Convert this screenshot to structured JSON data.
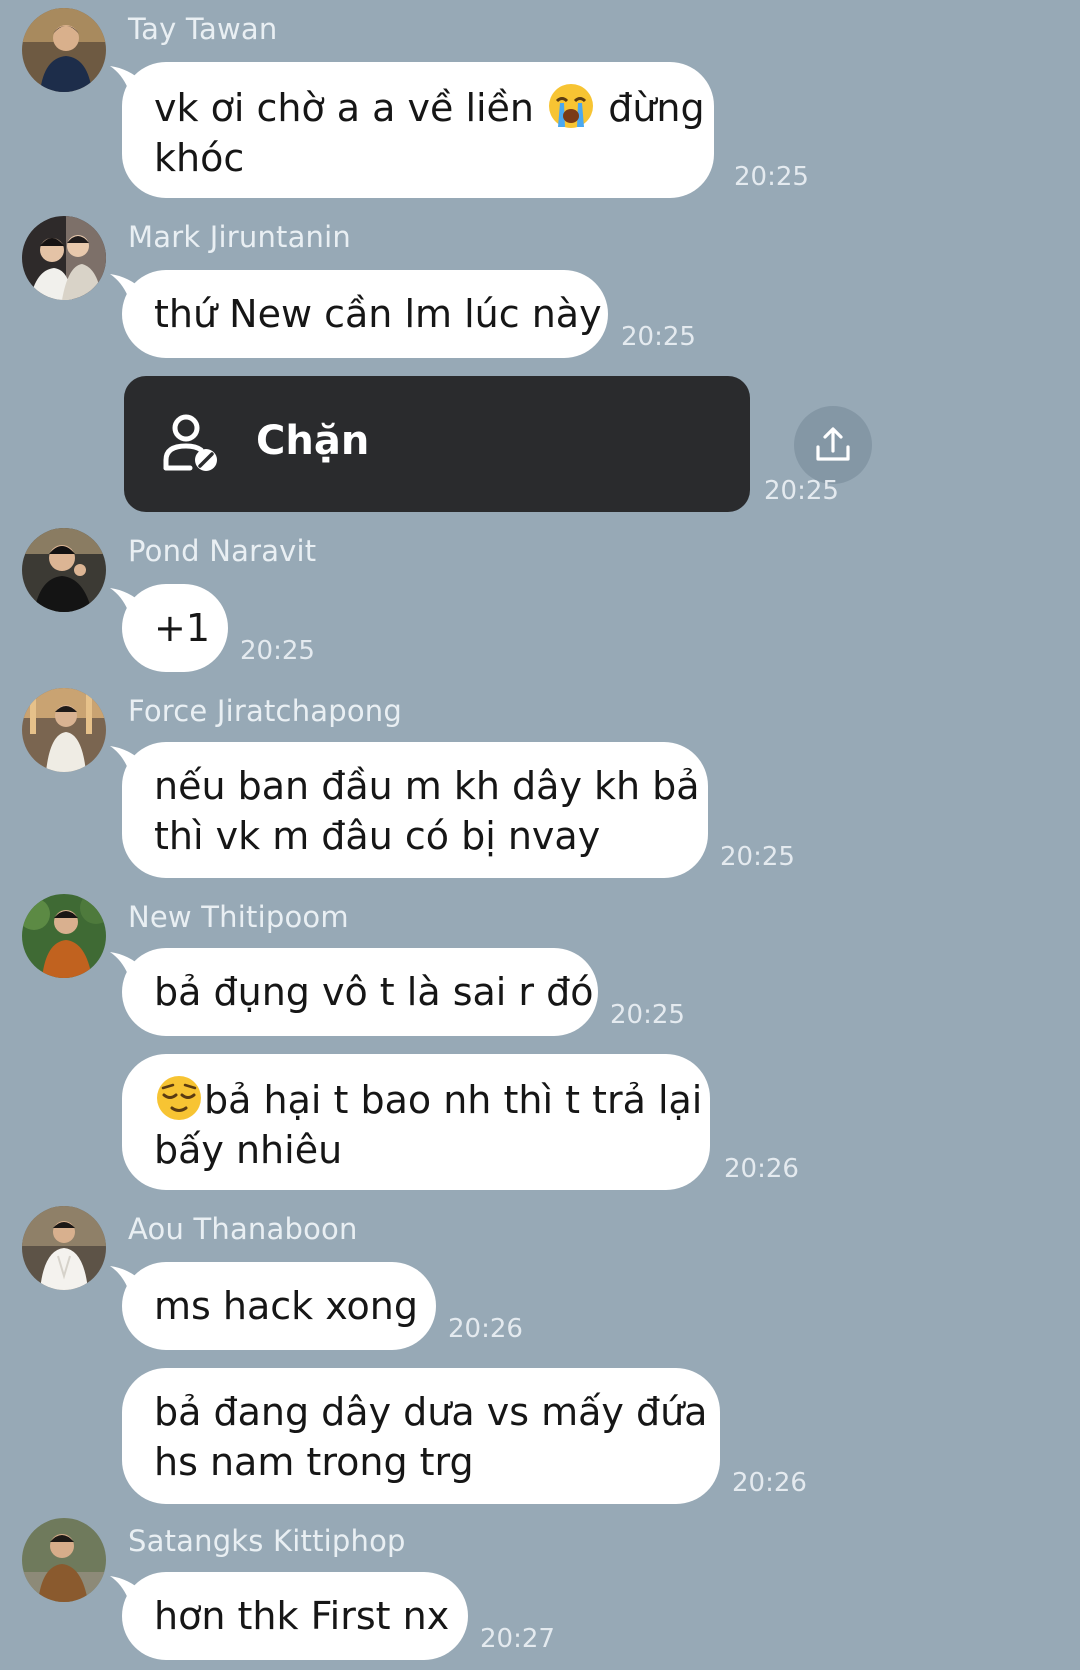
{
  "colors": {
    "background": "#97a9b6",
    "bubble": "#ffffff",
    "block_card": "#2a2b2d",
    "sender_text": "#e9eff3",
    "time_text": "#e4eaef"
  },
  "messages": [
    {
      "sender": "Tay Tawan",
      "bubbles": [
        {
          "line1_before": "vk ơi chờ a a về liền",
          "line1_after": "đừng",
          "line2": "khóc",
          "time": "20:25"
        }
      ]
    },
    {
      "sender": "Mark Jiruntanin",
      "bubbles": [
        {
          "text": "thứ New cần lm lúc này",
          "time": "20:25"
        }
      ]
    },
    {
      "block_card": {
        "icon": "block-user-icon",
        "label": "Chặn",
        "time": "20:25",
        "share_icon": "share-upload-icon"
      }
    },
    {
      "sender": "Pond Naravit",
      "bubbles": [
        {
          "text": "+1",
          "time": "20:25"
        }
      ]
    },
    {
      "sender": "Force Jiratchapong",
      "bubbles": [
        {
          "line1": "nếu ban đầu m kh dây kh bả",
          "line2": "thì vk m đâu có bị nvay",
          "time": "20:25"
        }
      ]
    },
    {
      "sender": "New Thitipoom",
      "bubbles": [
        {
          "text": "bả đụng vô t là sai r đó",
          "time": "20:25"
        },
        {
          "line1": "bả hại t bao nh thì t trả lại",
          "line2": "bấy nhiêu",
          "time": "20:26"
        }
      ]
    },
    {
      "sender": "Aou Thanaboon",
      "bubbles": [
        {
          "text": "ms hack xong",
          "time": "20:26"
        },
        {
          "line1": "bả đang dây dưa vs mấy đứa",
          "line2": "hs nam trong trg",
          "time": "20:26"
        }
      ]
    },
    {
      "sender": "Satangks Kittiphop",
      "bubbles": [
        {
          "text": "hơn thk First nx",
          "time": "20:27"
        }
      ]
    }
  ]
}
